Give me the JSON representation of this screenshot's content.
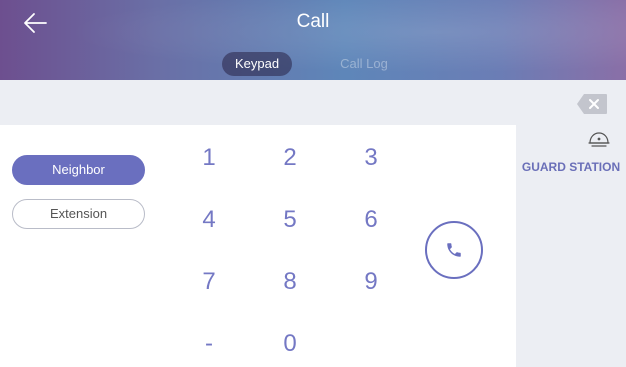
{
  "header": {
    "title": "Call",
    "tabs": [
      {
        "label": "Keypad",
        "active": true
      },
      {
        "label": "Call Log",
        "active": false
      }
    ]
  },
  "input": {
    "value": ""
  },
  "left_buttons": {
    "neighbor": "Neighbor",
    "extension": "Extension"
  },
  "keypad": {
    "keys": [
      "1",
      "2",
      "3",
      "4",
      "5",
      "6",
      "7",
      "8",
      "9",
      "-",
      "0"
    ]
  },
  "right_panel": {
    "guard_station": "GUARD STATION"
  },
  "icons": {
    "back": "back-arrow-icon",
    "clear": "backspace-icon",
    "call": "phone-icon",
    "guard": "guard-hat-icon"
  },
  "colors": {
    "accent": "#6a6fbf",
    "key_text": "#7478c4",
    "panel_bg": "#eceef3"
  }
}
